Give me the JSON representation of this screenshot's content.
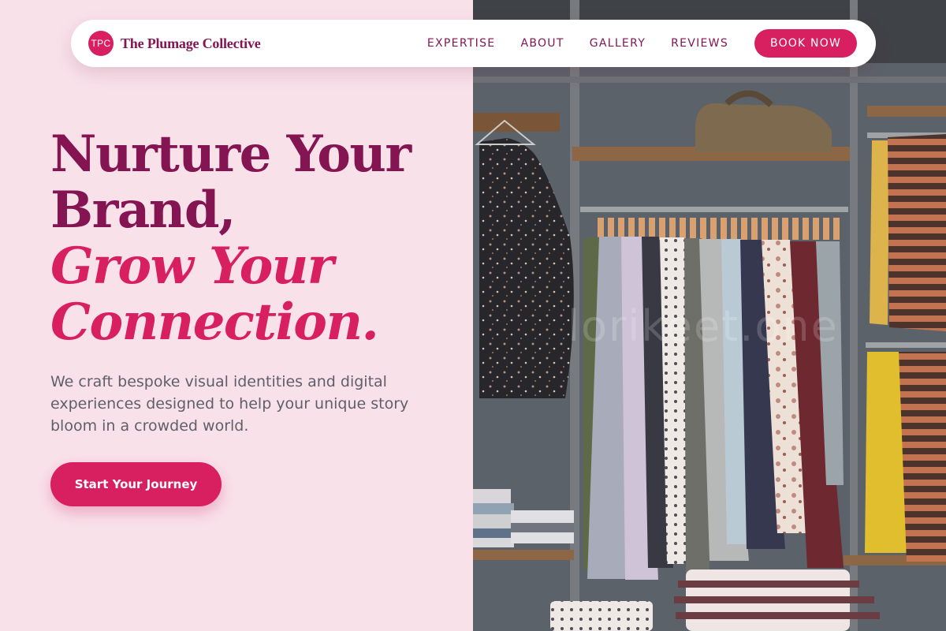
{
  "brand": {
    "mark": "TPC",
    "name": "The Plumage Collective"
  },
  "nav": {
    "links": [
      "EXPERTISE",
      "ABOUT",
      "GALLERY",
      "REVIEWS"
    ],
    "cta": "BOOK NOW"
  },
  "hero": {
    "line1": "Nurture Your",
    "line2": "Brand,",
    "line3": "Grow Your",
    "line4": "Connection.",
    "subtext": "We craft bespoke visual identities and digital experiences designed to help your unique story bloom in a crowded world.",
    "cta": "Start Your Journey"
  },
  "image": {
    "watermark": "lorikeet.one"
  },
  "colors": {
    "accent": "#d81f5f",
    "brand_text": "#841552",
    "page_bg": "#f9e1ea"
  }
}
